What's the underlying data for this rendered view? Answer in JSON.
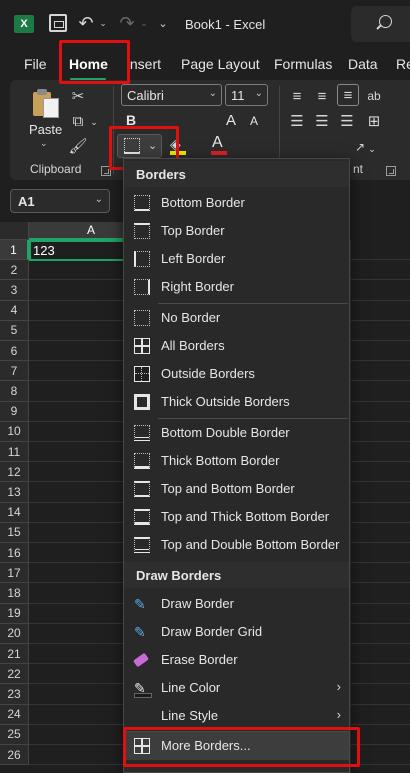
{
  "titlebar": {
    "app_icon": "excel-logo",
    "app_icon_glyph": "X",
    "undo_glyph": "↶",
    "redo_glyph": "↷",
    "caret": "⌄",
    "more": "⌄",
    "title": "Book1 - Excel"
  },
  "tabs": [
    {
      "label": "File"
    },
    {
      "label": "Home",
      "active": true
    },
    {
      "label": "Insert"
    },
    {
      "label": "Page Layout"
    },
    {
      "label": "Formulas"
    },
    {
      "label": "Data"
    },
    {
      "label": "Re"
    }
  ],
  "ribbon": {
    "clipboard": {
      "paste_label": "Paste",
      "group_label": "Clipboard"
    },
    "font": {
      "name": "Calibri",
      "size": "11",
      "bold": "B",
      "grow": "A",
      "shrink": "A",
      "font_color_letter": "A",
      "fill_color": "#f5e600",
      "font_color": "#e02020"
    },
    "alignment_group_label_fragment": "nt"
  },
  "formula_bar": {
    "name_box": "A1"
  },
  "grid": {
    "columns": [
      "A"
    ],
    "rows": [
      "1",
      "2",
      "3",
      "4",
      "5",
      "6",
      "7",
      "8",
      "9",
      "10",
      "11",
      "12",
      "13",
      "14",
      "15",
      "16",
      "17",
      "18",
      "19",
      "20",
      "21",
      "22",
      "23",
      "24",
      "25",
      "26"
    ],
    "cells": {
      "A1": "123"
    }
  },
  "borders_menu": {
    "header_borders": "Borders",
    "header_draw": "Draw Borders",
    "group1": [
      {
        "label": "Bottom Border",
        "icon": "bottom-border-icon"
      },
      {
        "label": "Top Border",
        "icon": "top-border-icon"
      },
      {
        "label": "Left Border",
        "icon": "left-border-icon"
      },
      {
        "label": "Right Border",
        "icon": "right-border-icon"
      }
    ],
    "group2": [
      {
        "label": "No Border",
        "icon": "no-border-icon"
      },
      {
        "label": "All Borders",
        "icon": "all-borders-icon"
      },
      {
        "label": "Outside Borders",
        "icon": "outside-borders-icon"
      },
      {
        "label": "Thick Outside Borders",
        "icon": "thick-outside-borders-icon"
      }
    ],
    "group3": [
      {
        "label": "Bottom Double Border",
        "icon": "bottom-double-border-icon"
      },
      {
        "label": "Thick Bottom Border",
        "icon": "thick-bottom-border-icon"
      },
      {
        "label": "Top and Bottom Border",
        "icon": "top-and-bottom-border-icon"
      },
      {
        "label": "Top and Thick Bottom Border",
        "icon": "top-thick-bottom-border-icon"
      },
      {
        "label": "Top and Double Bottom Border",
        "icon": "top-double-bottom-border-icon"
      }
    ],
    "draw": [
      {
        "label": "Draw Border",
        "icon": "draw-border-icon"
      },
      {
        "label": "Draw Border Grid",
        "icon": "draw-border-grid-icon"
      },
      {
        "label": "Erase Border",
        "icon": "eraser-icon"
      },
      {
        "label": "Line Color",
        "icon": "line-color-icon",
        "submenu": true
      },
      {
        "label": "Line Style",
        "icon": "",
        "submenu": true
      }
    ],
    "more": {
      "label": "More Borders...",
      "icon": "more-borders-icon"
    },
    "submenu_arrow": "›"
  },
  "colors": {
    "accent_green": "#21a366",
    "highlight_red": "#e01010"
  }
}
